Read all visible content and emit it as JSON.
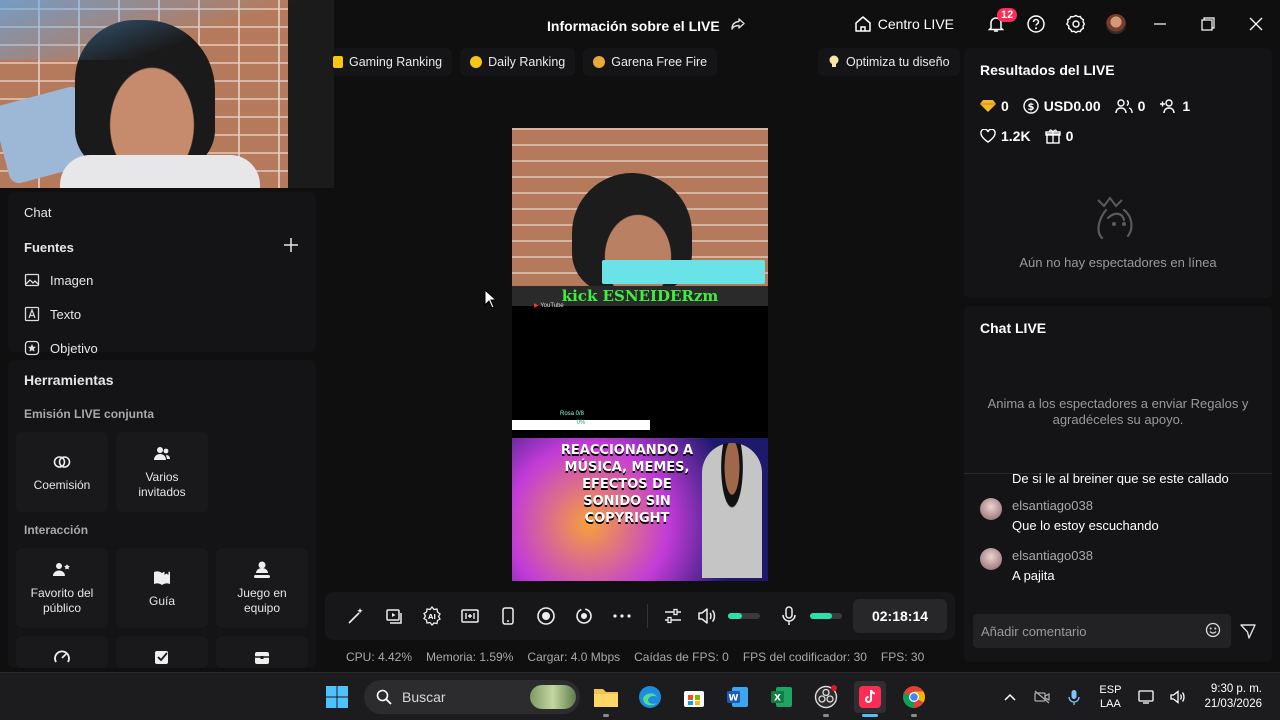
{
  "title_bar": {
    "title": "Información sobre el LIVE",
    "centro_live": "Centro LIVE",
    "notif_count": "12"
  },
  "left_panel": {
    "chat_label": "Chat",
    "sources_title": "Fuentes",
    "sources": [
      {
        "label": "Imagen",
        "icon": "image-icon"
      },
      {
        "label": "Texto",
        "icon": "text-icon"
      },
      {
        "label": "Objetivo",
        "icon": "target-icon"
      }
    ],
    "tools_title": "Herramientas",
    "coemission_title": "Emisión LIVE conjunta",
    "coemission_tools": [
      {
        "label": "Coemisión",
        "icon": "link-icon"
      },
      {
        "label": "Varios invitados",
        "icon": "guests-icon"
      }
    ],
    "interaction_title": "Interacción",
    "interaction_tools": [
      {
        "label": "Favorito del público",
        "icon": "audience-icon"
      },
      {
        "label": "Guía",
        "icon": "guide-icon"
      },
      {
        "label": "Juego en equipo",
        "icon": "team-icon"
      }
    ]
  },
  "top_chips": [
    {
      "label": "Gaming Ranking",
      "color": "#f5c518"
    },
    {
      "label": "Daily Ranking",
      "color": "#f5c518"
    },
    {
      "label": "Garena Free Fire",
      "color": "#e9a93a"
    }
  ],
  "optimize_chip": "Optimiza tu diseño",
  "stream_preview": {
    "kick_text": "kick ESNEIDERzm",
    "yt_label": "YouTube",
    "rosa_label": "Rosa 0/8",
    "progress_label": "0%",
    "thumb_title": "REACCIONANDO A MÚSICA, MEMES, EFECTOS DE SONIDO SIN COPYRIGHT"
  },
  "control_bar": {
    "timer": "02:18:14",
    "volume_level": 0.45,
    "mic_level": 0.7
  },
  "stats": {
    "cpu": "CPU:  4.42%",
    "memory": "Memoria:  1.59%",
    "upload": "Cargar:  4.0 Mbps",
    "fps_drops": "Caídas de FPS:  0",
    "encoder_fps": "FPS del codificador:  30",
    "fps": "FPS:  30"
  },
  "results": {
    "title": "Resultados del LIVE",
    "diamonds": "0",
    "usd": "USD0.00",
    "viewers": "0",
    "followers": "1",
    "likes": "1.2K",
    "gifts": "0",
    "empty_text": "Aún no hay espectadores en línea"
  },
  "chat_live": {
    "title": "Chat LIVE",
    "prompt": "Anima a los espectadores a enviar Regalos y agradéceles su apoyo.",
    "partial_message": "De si le al breiner que se este callado",
    "messages": [
      {
        "user": "elsantiago038",
        "text": "Que lo estoy escuchando"
      },
      {
        "user": "elsantiago038",
        "text": "A pajita"
      }
    ],
    "comment_placeholder": "Añadir comentario"
  },
  "taskbar": {
    "search": "Buscar",
    "lang_line1": "ESP",
    "lang_line2": "LAA",
    "time": "9:30 p. m.",
    "date": "21/03/2026"
  }
}
